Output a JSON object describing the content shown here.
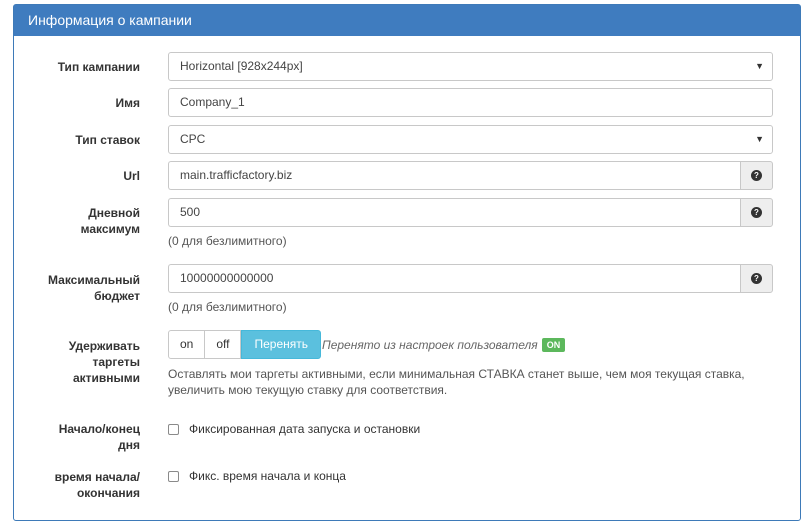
{
  "panel": {
    "title": "Информация о кампании"
  },
  "fields": {
    "campaign_type": {
      "label": "Тип кампании",
      "value": "Horizontal [928x244px]"
    },
    "name": {
      "label": "Имя",
      "value": "Company_1"
    },
    "bid_type": {
      "label": "Тип ставок",
      "value": "CPC"
    },
    "url": {
      "label": "Url",
      "value": "main.trafficfactory.biz"
    },
    "daily_max": {
      "label_line1": "Дневной",
      "label_line2": "максимум",
      "value": "500",
      "hint": "(0 для безлимитного)"
    },
    "max_budget": {
      "label_line1": "Максимальный",
      "label_line2": "бюджет",
      "value": "10000000000000",
      "hint": "(0 для безлимитного)"
    },
    "keep_targets": {
      "label_line1": "Удерживать",
      "label_line2": "таргеты",
      "label_line3": "активными",
      "options": [
        "on",
        "off",
        "Перенять"
      ],
      "selected": "Перенять",
      "inherited_text": "Перенято из настроек пользователя",
      "inherited_badge": "ON",
      "description_line1": "Оставлять мои таргеты активными, если минимальная СТАВКА станет выше, чем моя текущая ставка,",
      "description_line2": "увеличить мою текущую ставку для соответствия."
    },
    "start_end": {
      "label_line1": "Начало/конец",
      "label_line2": "дня",
      "checkbox_label": "Фиксированная дата запуска и остановки",
      "checked": false
    },
    "time_start_end": {
      "label_line1": "время начала/",
      "label_line2": "окончания",
      "checkbox_label": "Фикс. время начала и конца",
      "checked": false
    }
  },
  "icons": {
    "select_caret": "caret-down-icon",
    "help": "question-circle-icon"
  },
  "colors": {
    "header_bg": "#3f7cbf",
    "active_button": "#5bc0de",
    "badge_on": "#5cb85c"
  }
}
